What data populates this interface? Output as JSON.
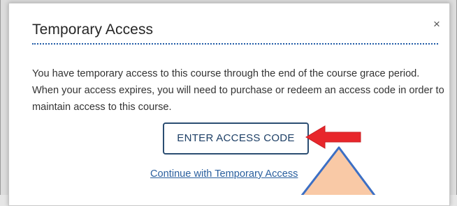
{
  "dialog": {
    "title": "Temporary Access",
    "close_symbol": "×",
    "message": "You have temporary access to this course through the end of the course grace period. When your access expires, you will need to purchase or redeem an access code in order to maintain access to this course.",
    "primary_button_label": "ENTER ACCESS CODE",
    "secondary_link_label": "Continue with Temporary Access"
  },
  "annotations": {
    "red_arrow_color": "#e8262b",
    "callout_fill_color": "#f9c9a6",
    "callout_stroke_color": "#3c6fc4"
  },
  "icons": {
    "close": "close-icon",
    "red_arrow": "arrow-left-icon",
    "callout": "callout-pointer-icon"
  }
}
